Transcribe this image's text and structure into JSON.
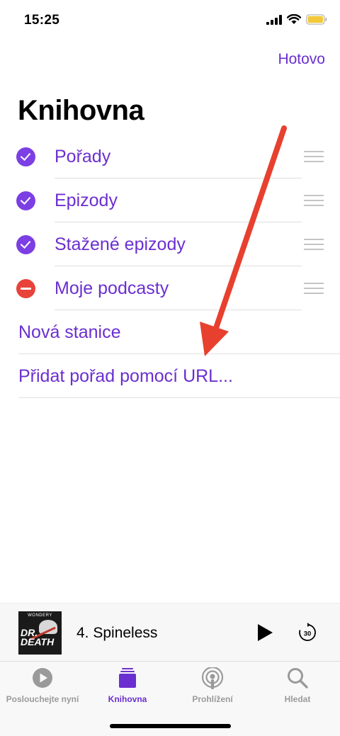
{
  "status": {
    "time": "15:25",
    "icons": [
      "signal-bars",
      "wifi",
      "battery"
    ]
  },
  "header": {
    "done_label": "Hotovo",
    "title": "Knihovna"
  },
  "library_items": [
    {
      "label": "Pořady",
      "state": "checked"
    },
    {
      "label": "Epizody",
      "state": "checked"
    },
    {
      "label": "Stažené epizody",
      "state": "checked"
    },
    {
      "label": "Moje podcasty",
      "state": "remove"
    }
  ],
  "actions": [
    {
      "label": "Nová stanice"
    },
    {
      "label": "Přidat pořad pomocí URL..."
    }
  ],
  "now_playing": {
    "artwork_brand": "WONDERY",
    "artwork_title": "DR. DEATH",
    "episode": "4. Spineless",
    "skip_seconds": "30"
  },
  "tabs": [
    {
      "label": "Poslouchejte nyní",
      "icon": "play-circle",
      "active": false
    },
    {
      "label": "Knihovna",
      "icon": "library-stack",
      "active": true
    },
    {
      "label": "Prohlížení",
      "icon": "podcast-antenna",
      "active": false
    },
    {
      "label": "Hledat",
      "icon": "magnifier",
      "active": false
    }
  ],
  "colors": {
    "accent": "#6b2fd0",
    "check": "#7b3fe4",
    "remove": "#e8433a",
    "annotation_arrow": "#e8402f"
  }
}
